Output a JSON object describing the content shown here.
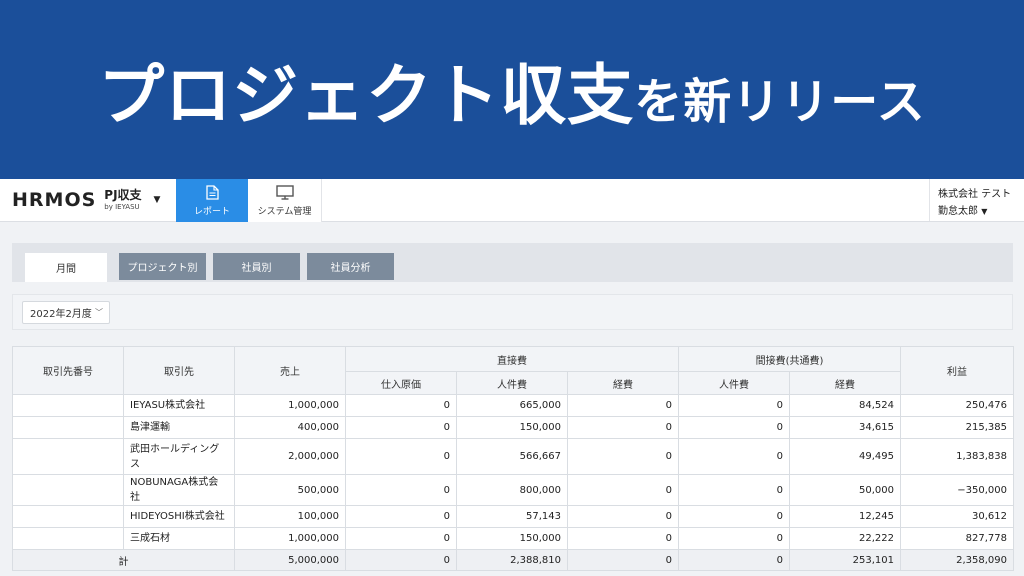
{
  "banner": {
    "title_main": "プロジェクト収支",
    "title_tail": "を新リリース",
    "bg_color": "#1b4f9a"
  },
  "header": {
    "logo": "HRMOS",
    "product_name": "PJ収支",
    "product_by": "by IEYASU",
    "nav": [
      {
        "label": "レポート",
        "icon": "document-icon",
        "active": true
      },
      {
        "label": "システム管理",
        "icon": "monitor-icon",
        "active": false
      }
    ],
    "company": "株式会社 テスト",
    "user_name": "勤怠太郎"
  },
  "tabs": [
    {
      "label": "月間",
      "active": true
    },
    {
      "label": "プロジェクト別",
      "active": false
    },
    {
      "label": "社員別",
      "active": false
    },
    {
      "label": "社員分析",
      "active": false
    }
  ],
  "filter": {
    "period": "2022年2月度"
  },
  "table": {
    "headers": {
      "client_no": "取引先番号",
      "client": "取引先",
      "sales": "売上",
      "direct": "直接費",
      "indirect": "間接費(共通費)",
      "profit": "利益",
      "purchase_cost": "仕入原価",
      "labor": "人件費",
      "expense": "経費",
      "labor2": "人件費",
      "expense2": "経費"
    },
    "rows": [
      {
        "no": "",
        "client": "IEYASU株式会社",
        "sales": "1,000,000",
        "purchase": "0",
        "labor": "665,000",
        "expense": "0",
        "ind_labor": "0",
        "ind_expense": "84,524",
        "profit": "250,476"
      },
      {
        "no": "",
        "client": "島津運輸",
        "sales": "400,000",
        "purchase": "0",
        "labor": "150,000",
        "expense": "0",
        "ind_labor": "0",
        "ind_expense": "34,615",
        "profit": "215,385"
      },
      {
        "no": "",
        "client": "武田ホールディングス",
        "sales": "2,000,000",
        "purchase": "0",
        "labor": "566,667",
        "expense": "0",
        "ind_labor": "0",
        "ind_expense": "49,495",
        "profit": "1,383,838"
      },
      {
        "no": "",
        "client": "NOBUNAGA株式会社",
        "sales": "500,000",
        "purchase": "0",
        "labor": "800,000",
        "expense": "0",
        "ind_labor": "0",
        "ind_expense": "50,000",
        "profit": "−350,000"
      },
      {
        "no": "",
        "client": "HIDEYOSHI株式会社",
        "sales": "100,000",
        "purchase": "0",
        "labor": "57,143",
        "expense": "0",
        "ind_labor": "0",
        "ind_expense": "12,245",
        "profit": "30,612"
      },
      {
        "no": "",
        "client": "三成石材",
        "sales": "1,000,000",
        "purchase": "0",
        "labor": "150,000",
        "expense": "0",
        "ind_labor": "0",
        "ind_expense": "22,222",
        "profit": "827,778"
      }
    ],
    "total": {
      "label": "計",
      "sales": "5,000,000",
      "purchase": "0",
      "labor": "2,388,810",
      "expense": "0",
      "ind_labor": "0",
      "ind_expense": "253,101",
      "profit": "2,358,090"
    }
  }
}
